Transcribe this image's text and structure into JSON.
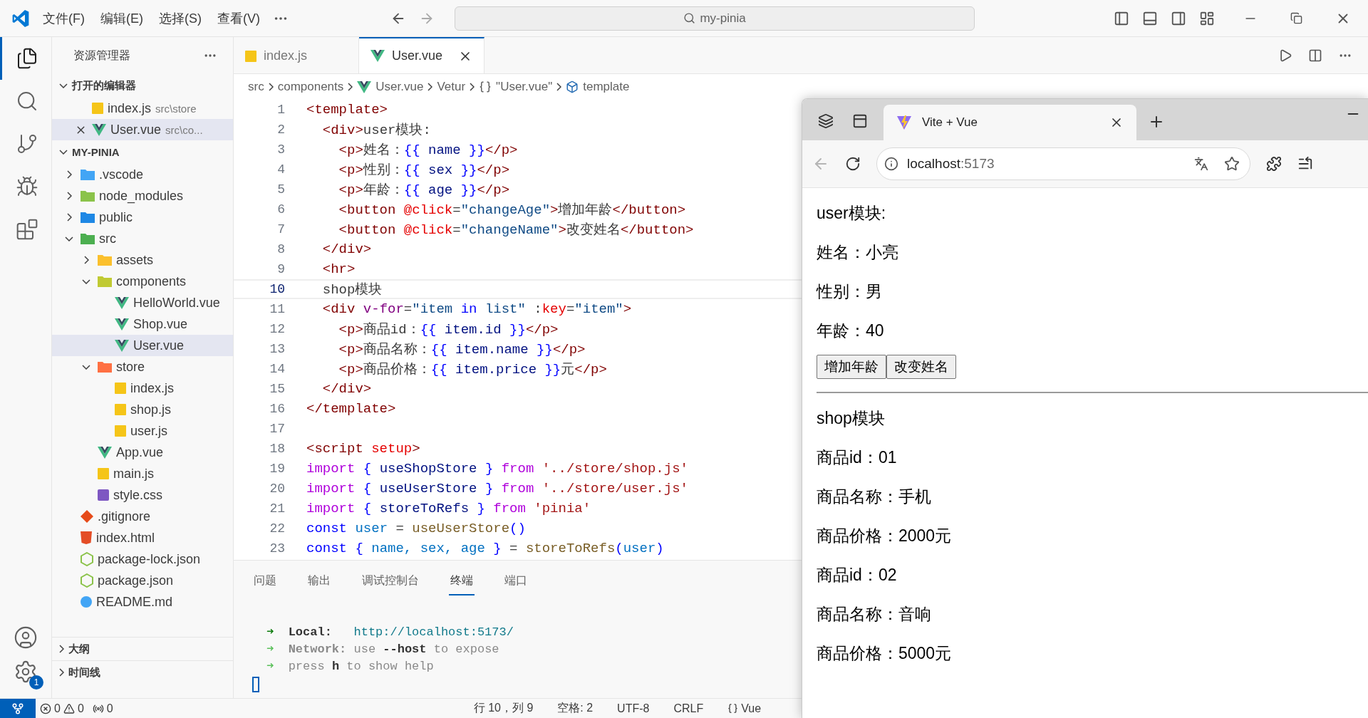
{
  "title_bar": {
    "menus": [
      "文件(F)",
      "编辑(E)",
      "选择(S)",
      "查看(V)"
    ],
    "search": {
      "value": "my-pinia"
    }
  },
  "activity_bar": {
    "items": [
      {
        "kind": "files",
        "selected": true
      },
      {
        "kind": "search",
        "selected": false
      },
      {
        "kind": "source",
        "selected": false
      },
      {
        "kind": "debug",
        "selected": false
      },
      {
        "kind": "extensions",
        "selected": false
      }
    ],
    "settings_badge": "1"
  },
  "sidebar": {
    "title": "资源管理器",
    "open_editors": {
      "title": "打开的编辑器",
      "expanded": true,
      "items": [
        {
          "name": "index.js",
          "kind": "js",
          "description": "src\\store",
          "selected": false
        },
        {
          "name": "User.vue",
          "kind": "vue",
          "description": "src\\co...",
          "selected": true
        }
      ]
    },
    "project": {
      "title": "MY-PINIA",
      "expanded": true,
      "tree": [
        {
          "name": ".vscode",
          "kind": "folder",
          "color": "#42a5f5",
          "expanded": false,
          "selected": false
        },
        {
          "name": "node_modules",
          "kind": "folder",
          "color": "#8bc34a",
          "expanded": false,
          "selected": false
        },
        {
          "name": "public",
          "kind": "folder",
          "color": "#1e88e5",
          "expanded": false,
          "selected": false
        },
        {
          "name": "src",
          "kind": "folder",
          "color": "#4caf50",
          "expanded": true,
          "selected": false,
          "children": [
            {
              "name": "assets",
              "kind": "folder",
              "color": "#fbc02d",
              "expanded": false,
              "selected": false
            },
            {
              "name": "components",
              "kind": "folder",
              "color": "#c0ca33",
              "expanded": true,
              "selected": false,
              "children": [
                {
                  "name": "HelloWorld.vue",
                  "kind": "vue",
                  "selected": false
                },
                {
                  "name": "Shop.vue",
                  "kind": "vue",
                  "selected": false
                },
                {
                  "name": "User.vue",
                  "kind": "vue",
                  "selected": true
                }
              ]
            },
            {
              "name": "store",
              "kind": "folder",
              "color": "#ff7043",
              "expanded": true,
              "selected": false,
              "children": [
                {
                  "name": "index.js",
                  "kind": "js",
                  "selected": false
                },
                {
                  "name": "shop.js",
                  "kind": "js",
                  "selected": false
                },
                {
                  "name": "user.js",
                  "kind": "js",
                  "selected": false
                }
              ]
            },
            {
              "name": "App.vue",
              "kind": "vue",
              "selected": false
            },
            {
              "name": "main.js",
              "kind": "js",
              "selected": false
            },
            {
              "name": "style.css",
              "kind": "css",
              "selected": false
            }
          ]
        },
        {
          "name": ".gitignore",
          "kind": "git",
          "selected": false
        },
        {
          "name": "index.html",
          "kind": "html",
          "selected": false
        },
        {
          "name": "package-lock.json",
          "kind": "json",
          "selected": false
        },
        {
          "name": "package.json",
          "kind": "json",
          "selected": false
        },
        {
          "name": "README.md",
          "kind": "md",
          "selected": false
        }
      ]
    },
    "sections": [
      {
        "title": "大纲",
        "expanded": false
      },
      {
        "title": "时间线",
        "expanded": false
      }
    ]
  },
  "editor_tabs": [
    {
      "label": "index.js",
      "kind": "js",
      "selected": false
    },
    {
      "label": "User.vue",
      "kind": "vue",
      "selected": true
    }
  ],
  "breadcrumb": [
    {
      "label": "src"
    },
    {
      "label": "components"
    },
    {
      "label": "User.vue",
      "kind": "vue"
    },
    {
      "label": "Vetur"
    },
    {
      "label": "\"User.vue\"",
      "kind": "object"
    },
    {
      "label": "template",
      "kind": "element"
    }
  ],
  "code_lines": [
    {
      "number": "1",
      "current": false,
      "tokens": [
        {
          "kind": "tag",
          "text": "<template>"
        }
      ]
    },
    {
      "number": "2",
      "current": false,
      "tokens": [
        {
          "kind": "tag",
          "text": "  <div>"
        },
        {
          "kind": "text",
          "text": "user模块:"
        }
      ]
    },
    {
      "number": "3",
      "current": false,
      "tokens": [
        {
          "kind": "tag",
          "text": "    <p>"
        },
        {
          "kind": "text",
          "text": "姓名："
        },
        {
          "kind": "brace",
          "text": "{{"
        },
        {
          "kind": "var",
          "text": " name "
        },
        {
          "kind": "brace",
          "text": "}}"
        },
        {
          "kind": "tag",
          "text": "</p>"
        }
      ]
    },
    {
      "number": "4",
      "current": false,
      "tokens": [
        {
          "kind": "tag",
          "text": "    <p>"
        },
        {
          "kind": "text",
          "text": "性别："
        },
        {
          "kind": "brace",
          "text": "{{"
        },
        {
          "kind": "var",
          "text": " sex "
        },
        {
          "kind": "brace",
          "text": "}}"
        },
        {
          "kind": "tag",
          "text": "</p>"
        }
      ]
    },
    {
      "number": "5",
      "current": false,
      "tokens": [
        {
          "kind": "tag",
          "text": "    <p>"
        },
        {
          "kind": "text",
          "text": "年龄："
        },
        {
          "kind": "brace",
          "text": "{{"
        },
        {
          "kind": "var",
          "text": " age "
        },
        {
          "kind": "brace",
          "text": "}}"
        },
        {
          "kind": "tag",
          "text": "</p>"
        }
      ]
    },
    {
      "number": "6",
      "current": false,
      "tokens": [
        {
          "kind": "tag",
          "text": "    <button "
        },
        {
          "kind": "attr",
          "text": "@click"
        },
        {
          "kind": "text",
          "text": "="
        },
        {
          "kind": "str",
          "text": "\"changeAge\""
        },
        {
          "kind": "tag",
          "text": ">"
        },
        {
          "kind": "text",
          "text": "增加年龄"
        },
        {
          "kind": "tag",
          "text": "</button>"
        }
      ]
    },
    {
      "number": "7",
      "current": false,
      "tokens": [
        {
          "kind": "tag",
          "text": "    <button "
        },
        {
          "kind": "attr",
          "text": "@click"
        },
        {
          "kind": "text",
          "text": "="
        },
        {
          "kind": "str",
          "text": "\"changeName\""
        },
        {
          "kind": "tag",
          "text": ">"
        },
        {
          "kind": "text",
          "text": "改变姓名"
        },
        {
          "kind": "tag",
          "text": "</button>"
        }
      ]
    },
    {
      "number": "8",
      "current": false,
      "tokens": [
        {
          "kind": "tag",
          "text": "  </div>"
        }
      ]
    },
    {
      "number": "9",
      "current": false,
      "tokens": [
        {
          "kind": "tag",
          "text": "  <hr>"
        }
      ]
    },
    {
      "number": "10",
      "current": true,
      "tokens": [
        {
          "kind": "text",
          "text": "  shop模块"
        }
      ]
    },
    {
      "number": "11",
      "current": false,
      "tokens": [
        {
          "kind": "tag",
          "text": "  <div "
        },
        {
          "kind": "dir",
          "text": "v-for"
        },
        {
          "kind": "text",
          "text": "="
        },
        {
          "kind": "str",
          "text": "\"item "
        },
        {
          "kind": "key",
          "text": "in"
        },
        {
          "kind": "str",
          "text": " list\""
        },
        {
          "kind": "text",
          "text": " :"
        },
        {
          "kind": "attr",
          "text": "key"
        },
        {
          "kind": "text",
          "text": "="
        },
        {
          "kind": "str",
          "text": "\"item\""
        },
        {
          "kind": "tag",
          "text": ">"
        }
      ]
    },
    {
      "number": "12",
      "current": false,
      "tokens": [
        {
          "kind": "tag",
          "text": "    <p>"
        },
        {
          "kind": "text",
          "text": "商品id："
        },
        {
          "kind": "brace",
          "text": "{{"
        },
        {
          "kind": "var",
          "text": " item.id "
        },
        {
          "kind": "brace",
          "text": "}}"
        },
        {
          "kind": "tag",
          "text": "</p>"
        }
      ]
    },
    {
      "number": "13",
      "current": false,
      "tokens": [
        {
          "kind": "tag",
          "text": "    <p>"
        },
        {
          "kind": "text",
          "text": "商品名称："
        },
        {
          "kind": "brace",
          "text": "{{"
        },
        {
          "kind": "var",
          "text": " item.name "
        },
        {
          "kind": "brace",
          "text": "}}"
        },
        {
          "kind": "tag",
          "text": "</p>"
        }
      ]
    },
    {
      "number": "14",
      "current": false,
      "tokens": [
        {
          "kind": "tag",
          "text": "    <p>"
        },
        {
          "kind": "text",
          "text": "商品价格："
        },
        {
          "kind": "brace",
          "text": "{{"
        },
        {
          "kind": "var",
          "text": " item.price "
        },
        {
          "kind": "brace",
          "text": "}}"
        },
        {
          "kind": "text",
          "text": "元"
        },
        {
          "kind": "tag",
          "text": "</p>"
        }
      ]
    },
    {
      "number": "15",
      "current": false,
      "tokens": [
        {
          "kind": "tag",
          "text": "  </div>"
        }
      ]
    },
    {
      "number": "16",
      "current": false,
      "tokens": [
        {
          "kind": "tag",
          "text": "</template>"
        }
      ]
    },
    {
      "number": "17",
      "current": false
    },
    {
      "number": "18",
      "current": false,
      "tokens": [
        {
          "kind": "tag",
          "text": "<script "
        },
        {
          "kind": "attr",
          "text": "setup"
        },
        {
          "kind": "tag",
          "text": ">"
        }
      ]
    },
    {
      "number": "19",
      "current": false,
      "tokens": [
        {
          "kind": "kw",
          "text": "import "
        },
        {
          "kind": "brace",
          "text": "{"
        },
        {
          "kind": "var",
          "text": " useShopStore "
        },
        {
          "kind": "brace",
          "text": "} "
        },
        {
          "kind": "kw",
          "text": "from "
        },
        {
          "kind": "jsstr",
          "text": "'../store/shop.js'"
        }
      ]
    },
    {
      "number": "20",
      "current": false,
      "tokens": [
        {
          "kind": "kw",
          "text": "import "
        },
        {
          "kind": "brace",
          "text": "{"
        },
        {
          "kind": "var",
          "text": " useUserStore "
        },
        {
          "kind": "brace",
          "text": "} "
        },
        {
          "kind": "kw",
          "text": "from "
        },
        {
          "kind": "jsstr",
          "text": "'../store/user.js'"
        }
      ]
    },
    {
      "number": "21",
      "current": false,
      "tokens": [
        {
          "kind": "kw",
          "text": "import "
        },
        {
          "kind": "brace",
          "text": "{"
        },
        {
          "kind": "var",
          "text": " storeToRefs "
        },
        {
          "kind": "brace",
          "text": "} "
        },
        {
          "kind": "kw",
          "text": "from "
        },
        {
          "kind": "jsstr",
          "text": "'pinia'"
        }
      ]
    },
    {
      "number": "22",
      "current": false,
      "tokens": [
        {
          "kind": "key",
          "text": "const "
        },
        {
          "kind": "def",
          "text": "user"
        },
        {
          "kind": "text",
          "text": " = "
        },
        {
          "kind": "fn",
          "text": "useUserStore"
        },
        {
          "kind": "brace",
          "text": "()"
        }
      ]
    },
    {
      "number": "23",
      "current": false,
      "tokens": [
        {
          "kind": "key",
          "text": "const "
        },
        {
          "kind": "brace",
          "text": "{"
        },
        {
          "kind": "def",
          "text": " name, sex, age "
        },
        {
          "kind": "brace",
          "text": "}"
        },
        {
          "kind": "text",
          "text": " = "
        },
        {
          "kind": "fn",
          "text": "storeToRefs"
        },
        {
          "kind": "brace",
          "text": "("
        },
        {
          "kind": "def",
          "text": "user"
        },
        {
          "kind": "brace",
          "text": ")"
        }
      ]
    }
  ],
  "panel": {
    "tabs": [
      {
        "label": "问题",
        "selected": false
      },
      {
        "label": "输出",
        "selected": false
      },
      {
        "label": "调试控制台",
        "selected": false
      },
      {
        "label": "终端",
        "selected": true
      },
      {
        "label": "端口",
        "selected": false
      }
    ],
    "terminal_lines": [
      [
        {
          "kind": "arrowbold",
          "text": "➜"
        },
        {
          "kind": "bold",
          "text": "  Local:"
        },
        {
          "kind": "url",
          "text": "   http://localhost:5173/"
        }
      ],
      [
        {
          "kind": "arrow",
          "text": "➜"
        },
        {
          "kind": "dimbold",
          "text": "  Network:"
        },
        {
          "kind": "dim",
          "text": " use "
        },
        {
          "kind": "bold",
          "text": "--host"
        },
        {
          "kind": "dim",
          "text": " to expose"
        }
      ],
      [
        {
          "kind": "arrow",
          "text": "➜"
        },
        {
          "kind": "dim",
          "text": "  press "
        },
        {
          "kind": "bold",
          "text": "h"
        },
        {
          "kind": "dim",
          "text": " to show help"
        }
      ]
    ]
  },
  "status_bar": {
    "errors": "0",
    "warnings": "0",
    "ports": "0",
    "position": "行 10，列 9",
    "indent": "空格: 2",
    "encoding": "UTF-8",
    "eol": "CRLF",
    "language": "Vue"
  },
  "browser": {
    "tab": {
      "title": "Vite + Vue"
    },
    "back_button": {
      "disabled": true
    },
    "address": {
      "host": "localhost",
      "port": ":5173"
    },
    "content": [
      {
        "kind": "text",
        "text": "user模块:"
      },
      {
        "kind": "text",
        "text": "姓名：小亮"
      },
      {
        "kind": "text",
        "text": "性别：男"
      },
      {
        "kind": "text",
        "text": "年龄：40"
      },
      {
        "kind": "buttons",
        "buttons": [
          "增加年龄",
          "改变姓名"
        ]
      },
      {
        "kind": "rule"
      },
      {
        "kind": "text",
        "text": "shop模块"
      },
      {
        "kind": "text",
        "text": "商品id：01"
      },
      {
        "kind": "text",
        "text": "商品名称：手机"
      },
      {
        "kind": "text",
        "text": "商品价格：2000元"
      },
      {
        "kind": "text",
        "text": "商品id：02"
      },
      {
        "kind": "text",
        "text": "商品名称：音响"
      },
      {
        "kind": "text",
        "text": "商品价格：5000元"
      }
    ]
  }
}
